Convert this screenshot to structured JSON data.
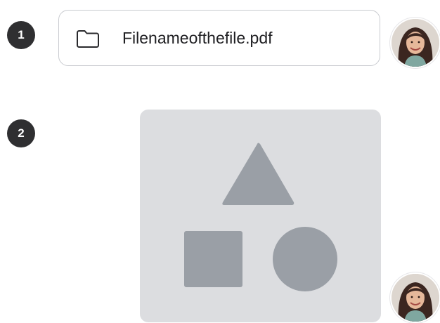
{
  "steps": [
    {
      "number": "1"
    },
    {
      "number": "2"
    }
  ],
  "file_message": {
    "filename": "Filenameofthefile.pdf",
    "icon": "folder-icon"
  },
  "image_message": {
    "icon": "image-placeholder-icon",
    "shapes": [
      "triangle",
      "square",
      "circle"
    ]
  },
  "avatars": [
    {
      "icon": "avatar"
    },
    {
      "icon": "avatar"
    }
  ],
  "colors": {
    "badge": "#2f2f31",
    "card_border": "#c9cbd0",
    "placeholder_bg": "#dcdde0",
    "placeholder_shapes": "#9a9fa6"
  }
}
